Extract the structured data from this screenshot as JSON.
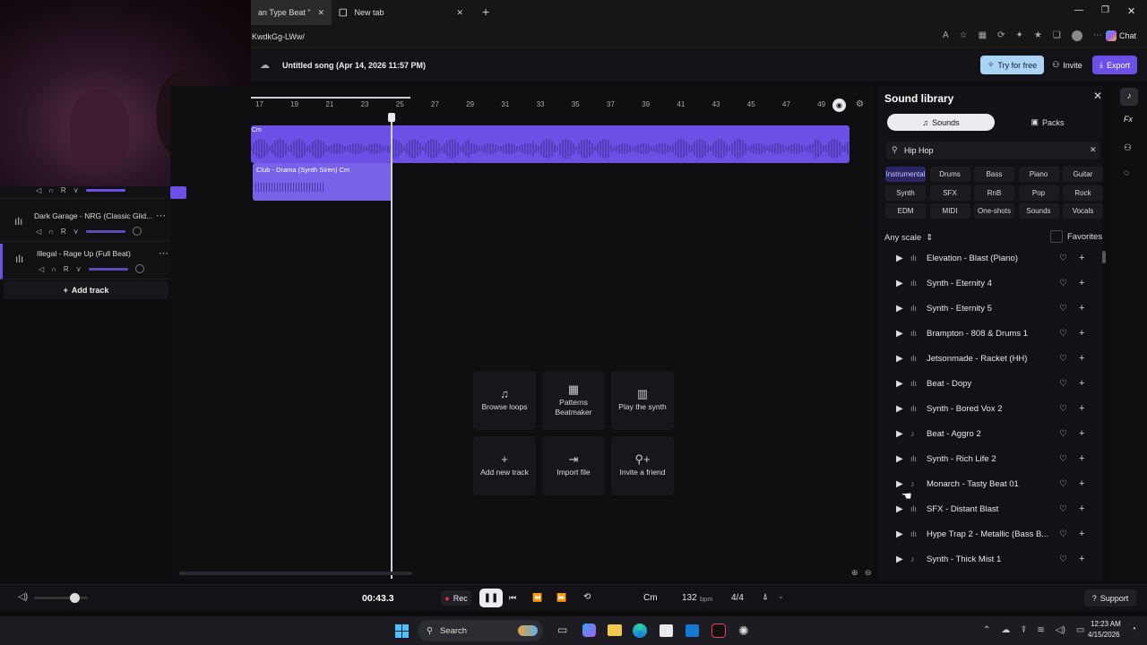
{
  "browser": {
    "tabs": [
      {
        "label": "an Type Beat \"SUMM"
      },
      {
        "label": "New tab"
      }
    ],
    "address": "KwdkGg-LWw/"
  },
  "app": {
    "song_title": "Untitled song (Apr 14, 2026 11:57 PM)",
    "try_free": "Try for free",
    "invite": "Invite",
    "export": "Export",
    "accent": "#6c4fe4"
  },
  "ruler": {
    "ticks": [
      "17",
      "19",
      "21",
      "23",
      "25",
      "27",
      "29",
      "31",
      "33",
      "35",
      "37",
      "39",
      "41",
      "43",
      "45",
      "47",
      "49"
    ]
  },
  "clips": {
    "main_label": "Cm",
    "second_label": "Club - Drama (Synth Siren) Cm"
  },
  "tracks": [
    {
      "name": "Dark Garage - NRG (Classic Glid..."
    },
    {
      "name": "Illegal - Rage Up (Full Beat)"
    }
  ],
  "add_track": "Add track",
  "center_actions": [
    {
      "label": "Browse loops",
      "icon": "music-note-icon"
    },
    {
      "label": "Patterns Beatmaker",
      "icon": "grid-icon"
    },
    {
      "label": "Play the synth",
      "icon": "piano-icon"
    },
    {
      "label": "Add new track",
      "icon": "plus-icon"
    },
    {
      "label": "Import file",
      "icon": "import-icon"
    },
    {
      "label": "Invite a friend",
      "icon": "person-add-icon"
    }
  ],
  "library": {
    "title": "Sound library",
    "tab_sounds": "Sounds",
    "tab_packs": "Packs",
    "search_value": "Hip Hop",
    "chips": [
      "Instrumental",
      "Drums",
      "Bass",
      "Piano",
      "Guitar",
      "Synth",
      "SFX",
      "RnB",
      "Pop",
      "Rock",
      "EDM",
      "MIDI",
      "One-shots",
      "Sounds",
      "Vocals"
    ],
    "scale": "Any scale",
    "favorites": "Favorites",
    "items": [
      {
        "name": "Elevation - Blast (Piano)",
        "type": "wave"
      },
      {
        "name": "Synth - Eternity 4",
        "type": "wave"
      },
      {
        "name": "Synth - Eternity 5",
        "type": "wave"
      },
      {
        "name": "Brampton - 808 & Drums 1",
        "type": "wave"
      },
      {
        "name": "Jetsonmade - Racket (HH)",
        "type": "wave"
      },
      {
        "name": "Beat - Dopy",
        "type": "wave"
      },
      {
        "name": "Synth - Bored Vox 2",
        "type": "wave"
      },
      {
        "name": "Beat - Aggro 2",
        "type": "midi"
      },
      {
        "name": "Synth - Rich Life 2",
        "type": "wave"
      },
      {
        "name": "Monarch - Tasty Beat 01",
        "type": "midi"
      },
      {
        "name": "SFX - Distant Blast",
        "type": "wave"
      },
      {
        "name": "Hype Trap 2 - Metallic (Bass B...",
        "type": "wave"
      },
      {
        "name": "Synth - Thick Mist 1",
        "type": "midi"
      }
    ]
  },
  "transport": {
    "time": "00:43.3",
    "rec": "Rec",
    "key": "Cm",
    "bpm": "132",
    "bpm_unit": "bpm",
    "signature": "4/4",
    "support": "Support"
  },
  "taskbar": {
    "search": "Search",
    "time": "12:23 AM",
    "date": "4/15/2026"
  }
}
